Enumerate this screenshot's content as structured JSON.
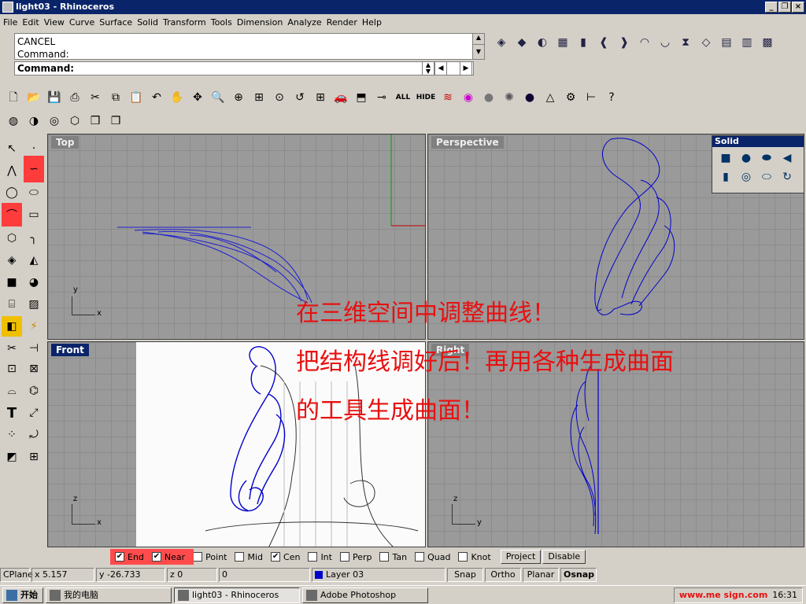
{
  "window": {
    "title": "light03 - Rhinoceros"
  },
  "menu": [
    "File",
    "Edit",
    "View",
    "Curve",
    "Surface",
    "Solid",
    "Transform",
    "Tools",
    "Dimension",
    "Analyze",
    "Render",
    "Help"
  ],
  "command": {
    "history": [
      "CANCEL",
      "Command:"
    ],
    "prompt": "Command:"
  },
  "std_toolbar": {
    "all_label": "ALL",
    "hide_label": "HIDE"
  },
  "viewports": {
    "top": {
      "label": "Top"
    },
    "perspective": {
      "label": "Perspective"
    },
    "front": {
      "label": "Front"
    },
    "right": {
      "label": "Right"
    }
  },
  "axis": {
    "x": "x",
    "y": "y",
    "z": "z"
  },
  "solid_palette": {
    "title": "Solid"
  },
  "overlay": {
    "line1": "在三维空间中调整曲线！",
    "line2": "把结构线调好后！再用各种生成曲面",
    "line3": "的工具生成曲面！"
  },
  "osnap": {
    "items": [
      {
        "label": "End",
        "checked": true
      },
      {
        "label": "Near",
        "checked": true
      },
      {
        "label": "Point",
        "checked": false
      },
      {
        "label": "Mid",
        "checked": false
      },
      {
        "label": "Cen",
        "checked": true
      },
      {
        "label": "Int",
        "checked": false
      },
      {
        "label": "Perp",
        "checked": false
      },
      {
        "label": "Tan",
        "checked": false
      },
      {
        "label": "Quad",
        "checked": false
      },
      {
        "label": "Knot",
        "checked": false
      }
    ],
    "project": "Project",
    "disable": "Disable"
  },
  "status": {
    "cplane": "CPlane",
    "x": "x 5.157",
    "y": "y -26.733",
    "z": "z 0",
    "zero": "0",
    "layer": "Layer 03",
    "snap": "Snap",
    "ortho": "Ortho",
    "planar": "Planar",
    "osnap": "Osnap"
  },
  "taskbar": {
    "start": "开始",
    "items": [
      "我的电脑",
      "light03 - Rhinoceros",
      "Adobe Photoshop"
    ],
    "watermark": "www.me     sign.com",
    "clock": "16:31"
  },
  "colors": {
    "titlebar": "#0a246a",
    "overlay_text": "#e81010",
    "curve": "#0000cc",
    "viewport_bg": "#9a9a9a"
  }
}
